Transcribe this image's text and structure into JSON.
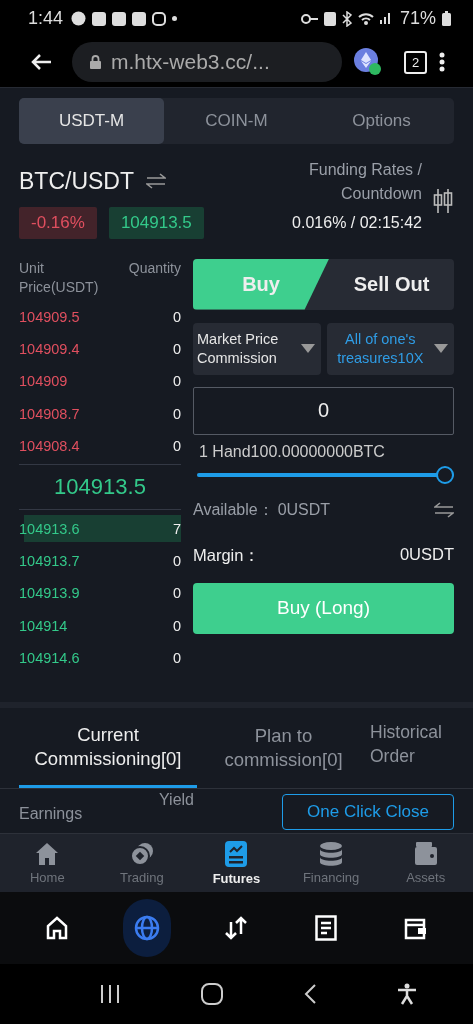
{
  "status_bar": {
    "time": "1:44",
    "battery": "71%"
  },
  "browser": {
    "url": "m.htx-web3.cc/...",
    "tab_count": "2"
  },
  "market_tabs": [
    {
      "label": "USDT-M",
      "selected": true
    },
    {
      "label": "COIN-M",
      "selected": false
    },
    {
      "label": "Options",
      "selected": false
    }
  ],
  "pair": {
    "symbol": "BTC/USDT",
    "change": "-0.16%",
    "price": "104913.5",
    "funding_label": "Funding Rates / Countdown",
    "funding_value": "0.016% / 02:15:42"
  },
  "order_book": {
    "price_header": "Unit Price(USDT)",
    "quantity_header": "Quantity",
    "last_price": "104913.5",
    "rows": [
      {
        "kind": "ask",
        "price": "104909.5",
        "quantity": "0",
        "highlighted": false
      },
      {
        "kind": "ask",
        "price": "104909.4",
        "quantity": "0",
        "highlighted": false
      },
      {
        "kind": "ask",
        "price": "104909",
        "quantity": "0",
        "highlighted": false
      },
      {
        "kind": "ask",
        "price": "104908.7",
        "quantity": "0",
        "highlighted": false
      },
      {
        "kind": "ask",
        "price": "104908.4",
        "quantity": "0",
        "highlighted": false
      },
      {
        "kind": "bid",
        "price": "104913.6",
        "quantity": "7",
        "highlighted": true
      },
      {
        "kind": "bid",
        "price": "104913.7",
        "quantity": "0",
        "highlighted": false
      },
      {
        "kind": "bid",
        "price": "104913.9",
        "quantity": "0",
        "highlighted": false
      },
      {
        "kind": "bid",
        "price": "104914",
        "quantity": "0",
        "highlighted": false
      },
      {
        "kind": "bid",
        "price": "104914.6",
        "quantity": "0",
        "highlighted": false
      }
    ]
  },
  "trade": {
    "sides": [
      {
        "label": "Buy",
        "selected": true
      },
      {
        "label": "Sell Out",
        "selected": false
      }
    ],
    "order_type": "Market Price Commission",
    "leverage": "All of one's treasures10X",
    "amount": "0",
    "lot_info": "1 Hand100.00000000BTC",
    "slider": {
      "level": 1
    },
    "available_label": "Available：",
    "available_value": "0USDT",
    "margin_label": "Margin：",
    "margin_value": "0USDT",
    "submit": "Buy (Long)"
  },
  "order_tabs": [
    {
      "label": "Current Commissioning[0]",
      "selected": true
    },
    {
      "label": "Plan to commission[0]",
      "selected": false
    },
    {
      "label": "Historical Order",
      "selected": false
    }
  ],
  "positions": {
    "column_1": "Earnings",
    "column_2": "Yield",
    "close_all": "One Click Close"
  },
  "app_nav": [
    {
      "kind": "home",
      "label": "Home",
      "selected": false
    },
    {
      "kind": "trading",
      "label": "Trading",
      "selected": false
    },
    {
      "kind": "futures",
      "label": "Futures",
      "selected": true
    },
    {
      "kind": "financing",
      "label": "Financing",
      "selected": false
    },
    {
      "kind": "assets",
      "label": "Assets",
      "selected": false
    }
  ],
  "browser_nav": [
    {
      "kind": "home",
      "selected": false
    },
    {
      "kind": "globe",
      "selected": true
    },
    {
      "kind": "swap",
      "selected": false
    },
    {
      "kind": "document",
      "selected": false
    },
    {
      "kind": "wallet",
      "selected": false
    }
  ]
}
